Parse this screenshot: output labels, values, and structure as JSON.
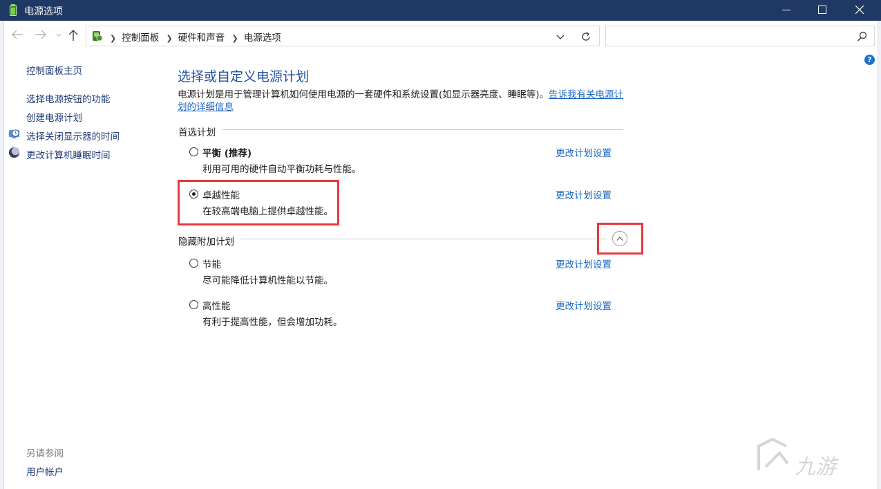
{
  "window": {
    "title": "电源选项",
    "controls": [
      "minimize",
      "maximize",
      "close"
    ]
  },
  "address": {
    "breadcrumbs": [
      "控制面板",
      "硬件和声音",
      "电源选项"
    ],
    "search_placeholder": ""
  },
  "sidebar": {
    "home": "控制面板主页",
    "links": [
      {
        "label": "选择电源按钮的功能",
        "icon": ""
      },
      {
        "label": "创建电源计划",
        "icon": ""
      },
      {
        "label": "选择关闭显示器的时间",
        "icon": "monitor-clock-icon"
      },
      {
        "label": "更改计算机睡眠时间",
        "icon": "moon-icon"
      }
    ],
    "see_also_label": "另请参阅",
    "see_also_links": [
      "用户帐户"
    ]
  },
  "main": {
    "title": "选择或自定义电源计划",
    "description": "电源计划是用于管理计算机如何使用电源的一套硬件和系统设置(如显示器亮度、睡眠等)。",
    "description_link": "告诉我有关电源计划的详细信息",
    "preferred_label": "首选计划",
    "hidden_label": "隐藏附加计划",
    "plans": [
      {
        "name": "平衡 (推荐)",
        "desc": "利用可用的硬件自动平衡功耗与性能。",
        "link": "更改计划设置",
        "selected": false,
        "bold": true
      },
      {
        "name": "卓越性能",
        "desc": "在较高端电脑上提供卓越性能。",
        "link": "更改计划设置",
        "selected": true,
        "bold": false
      },
      {
        "name": "节能",
        "desc": "尽可能降低计算机性能以节能。",
        "link": "更改计划设置",
        "selected": false,
        "bold": false
      },
      {
        "name": "高性能",
        "desc": "有利于提高性能，但会增加功耗。",
        "link": "更改计划设置",
        "selected": false,
        "bold": false
      }
    ]
  },
  "colors": {
    "titlebar": "#1f3864",
    "link": "#1a66c2",
    "heading": "#1f4fa0",
    "highlight": "#e8383d"
  },
  "watermark": {
    "text": "九游"
  }
}
